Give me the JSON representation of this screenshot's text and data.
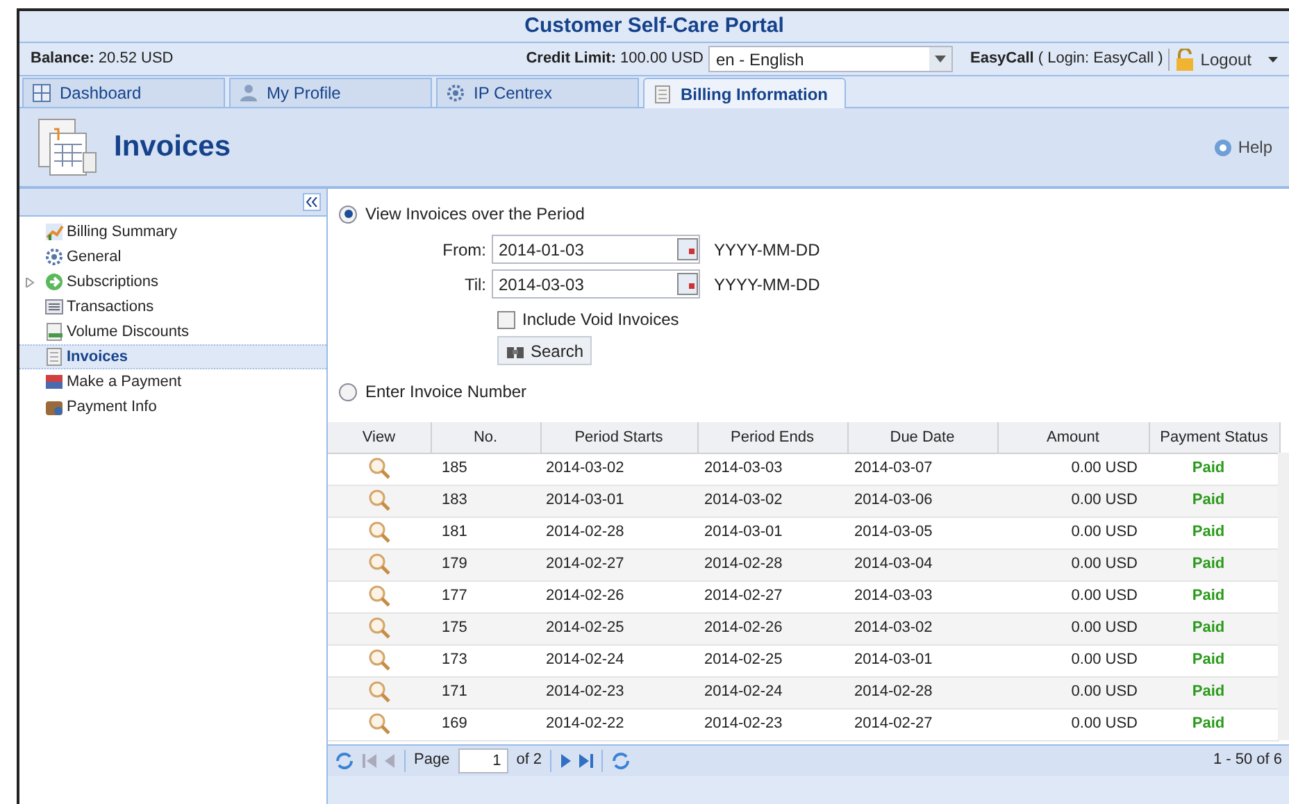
{
  "window": {
    "title": "Customer Self-Care Portal"
  },
  "info_bar": {
    "balance_label": "Balance:",
    "balance": "20.52 USD",
    "credit_label": "Credit Limit:",
    "credit": "100.00 USD",
    "language": "en - English",
    "user": "EasyCall",
    "login": "( Login: EasyCall )",
    "logout": "Logout"
  },
  "tabs": [
    {
      "label": "Dashboard",
      "kind": "dashboard",
      "selected": false
    },
    {
      "label": "My Profile",
      "kind": "profile",
      "selected": false
    },
    {
      "label": "IP Centrex",
      "kind": "gear",
      "selected": false
    },
    {
      "label": "Billing Information",
      "kind": "document",
      "selected": true
    }
  ],
  "page_header": {
    "title": "Invoices",
    "help": "Help"
  },
  "sidebar": {
    "items": [
      {
        "label": "Billing Summary",
        "kind": "chart",
        "selected": false
      },
      {
        "label": "General",
        "kind": "gear",
        "selected": false
      },
      {
        "label": "Subscriptions",
        "kind": "arrow",
        "selected": false,
        "expanded": false
      },
      {
        "label": "Transactions",
        "kind": "list",
        "selected": false
      },
      {
        "label": "Volume Discounts",
        "kind": "discount",
        "selected": false
      },
      {
        "label": "Invoices",
        "kind": "document",
        "selected": true
      },
      {
        "label": "Make a Payment",
        "kind": "card",
        "selected": false
      },
      {
        "label": "Payment Info",
        "kind": "wallet",
        "selected": false
      }
    ]
  },
  "filter": {
    "period_option": {
      "label": "View Invoices over the Period",
      "selected": true
    },
    "from": {
      "label": "From:",
      "value": "2014-01-03",
      "hint": "YYYY-MM-DD"
    },
    "til": {
      "label": "Til:",
      "value": "2014-03-03",
      "hint": "YYYY-MM-DD"
    },
    "void_invoices": {
      "label": "Include Void Invoices",
      "checked": false
    },
    "search": "Search",
    "number_option": {
      "label": "Enter Invoice Number",
      "selected": false
    }
  },
  "table": {
    "columns": [
      "View",
      "No.",
      "Period Starts",
      "Period Ends",
      "Due Date",
      "Amount",
      "Payment Status"
    ],
    "rows": [
      {
        "no": "185",
        "start": "2014-03-02",
        "end": "2014-03-03",
        "due": "2014-03-07",
        "amount": "0.00 USD",
        "status": "Paid"
      },
      {
        "no": "183",
        "start": "2014-03-01",
        "end": "2014-03-02",
        "due": "2014-03-06",
        "amount": "0.00 USD",
        "status": "Paid"
      },
      {
        "no": "181",
        "start": "2014-02-28",
        "end": "2014-03-01",
        "due": "2014-03-05",
        "amount": "0.00 USD",
        "status": "Paid"
      },
      {
        "no": "179",
        "start": "2014-02-27",
        "end": "2014-02-28",
        "due": "2014-03-04",
        "amount": "0.00 USD",
        "status": "Paid"
      },
      {
        "no": "177",
        "start": "2014-02-26",
        "end": "2014-02-27",
        "due": "2014-03-03",
        "amount": "0.00 USD",
        "status": "Paid"
      },
      {
        "no": "175",
        "start": "2014-02-25",
        "end": "2014-02-26",
        "due": "2014-03-02",
        "amount": "0.00 USD",
        "status": "Paid"
      },
      {
        "no": "173",
        "start": "2014-02-24",
        "end": "2014-02-25",
        "due": "2014-03-01",
        "amount": "0.00 USD",
        "status": "Paid"
      },
      {
        "no": "171",
        "start": "2014-02-23",
        "end": "2014-02-24",
        "due": "2014-02-28",
        "amount": "0.00 USD",
        "status": "Paid"
      },
      {
        "no": "169",
        "start": "2014-02-22",
        "end": "2014-02-23",
        "due": "2014-02-27",
        "amount": "0.00 USD",
        "status": "Paid"
      }
    ]
  },
  "pager": {
    "page_label": "Page",
    "page": "1",
    "of": "of 2",
    "range": "1 - 50 of 6"
  }
}
